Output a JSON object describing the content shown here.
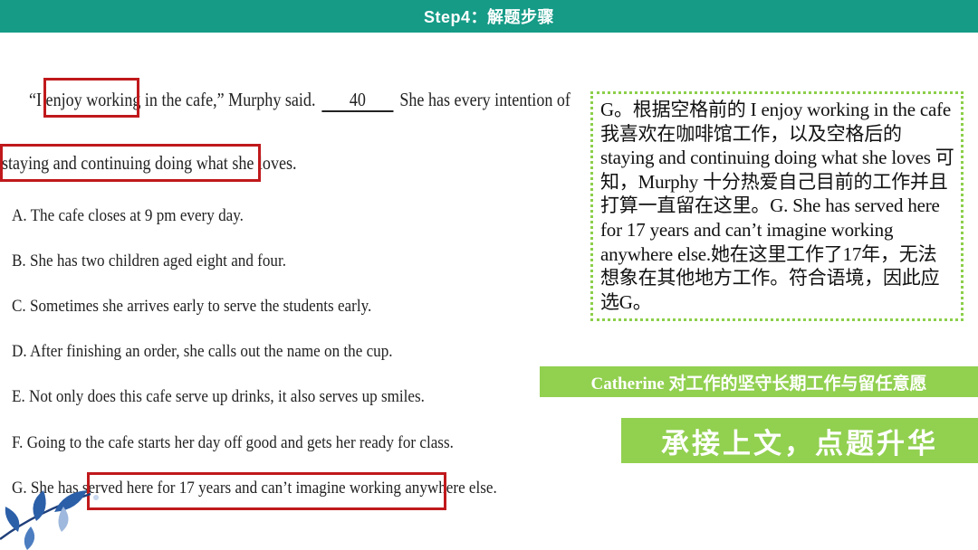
{
  "header": {
    "title": "Step4：解题步骤"
  },
  "passage": {
    "quote_open": "“I ",
    "highlight_1": "enjoy working",
    "quote_rest": " in the cafe,” Murphy said.",
    "blank_number": "40",
    "after_blank": "She has every intention of",
    "continuation": "staying and continuing doing what she loves."
  },
  "options": [
    "A. The cafe closes at 9 pm every day.",
    "B. She has two children aged eight and four.",
    "C. Sometimes she arrives early to serve the students early.",
    "D. After finishing an order, she calls out the name on the cup.",
    "E. Not only does this cafe serve up drinks, it also serves up smiles.",
    "F. Going to the cafe starts her day off good and gets her ready for class."
  ],
  "option_g": {
    "prefix": "G. She has ",
    "highlight": "served here for 17 years and can’t imagine working",
    "suffix": " anywhere else."
  },
  "explanation": "G。根据空格前的 I enjoy working in the cafe我喜欢在咖啡馆工作，以及空格后的 staying and continuing doing what she loves 可知，Murphy 十分热爱自己目前的工作并且打算一直留在这里。G. She has served here for 17 years and can’t imagine working anywhere else.她在这里工作了17年，无法想象在其他地方工作。符合语境，因此应选G。",
  "banners": {
    "theme": "Catherine 对工作的坚守长期工作与留任意愿",
    "summary": "承接上文，点题升华"
  },
  "colors": {
    "header_bg": "#169b87",
    "highlight_box": "#c0191c",
    "banner_green": "#92d050",
    "explain_border": "#8ccf4a",
    "decoration_blue": "#2b5fa8"
  }
}
